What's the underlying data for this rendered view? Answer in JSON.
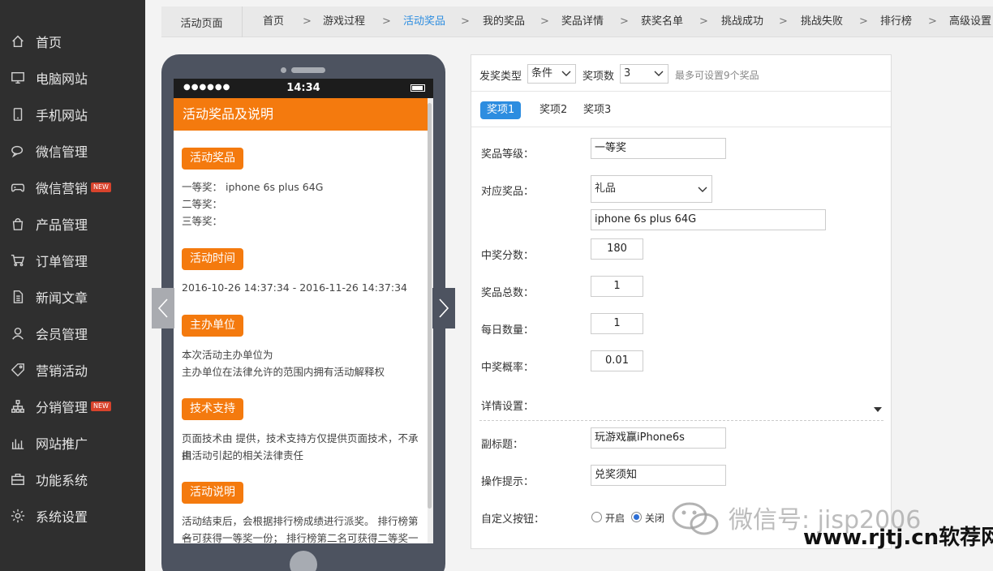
{
  "sidebar": {
    "items": [
      {
        "label": "首页",
        "icon": "home-icon"
      },
      {
        "label": "电脑网站",
        "icon": "monitor-icon"
      },
      {
        "label": "手机网站",
        "icon": "phone-icon"
      },
      {
        "label": "微信管理",
        "icon": "chat-icon"
      },
      {
        "label": "微信营销",
        "icon": "gamepad-icon",
        "badge": "NEW"
      },
      {
        "label": "产品管理",
        "icon": "bag-icon"
      },
      {
        "label": "订单管理",
        "icon": "cart-icon"
      },
      {
        "label": "新闻文章",
        "icon": "document-icon"
      },
      {
        "label": "会员管理",
        "icon": "user-icon"
      },
      {
        "label": "营销活动",
        "icon": "tag-icon"
      },
      {
        "label": "分销管理",
        "icon": "network-icon",
        "badge": "NEW"
      },
      {
        "label": "网站推广",
        "icon": "bar-chart-icon"
      },
      {
        "label": "功能系统",
        "icon": "toolbox-icon"
      },
      {
        "label": "系统设置",
        "icon": "gear-icon"
      }
    ]
  },
  "topnav": {
    "first": "活动页面",
    "items": [
      "首页",
      "游戏过程",
      "活动奖品",
      "我的奖品",
      "奖品详情",
      "获奖名单",
      "挑战成功",
      "挑战失败",
      "排行榜",
      "高级设置"
    ],
    "active_index": 2,
    "separator": ">"
  },
  "phone": {
    "status": {
      "signal": "●●●●●●",
      "time": "14:34"
    },
    "header": "活动奖品及说明",
    "sections": {
      "prize_badge": "活动奖品",
      "prize_lines": [
        "一等奖： iphone 6s plus 64G",
        "二等奖：",
        "三等奖："
      ],
      "time_badge": "活动时间",
      "time_text": "2016-10-26 14:37:34 - 2016-11-26 14:37:34",
      "host_badge": "主办单位",
      "host_lines": [
        "本次活动主办单位为",
        "主办单位在法律允许的范围内拥有活动解释权"
      ],
      "tech_badge": "技术支持",
      "tech_lines": [
        "页面技术由 提供，技术支持方仅提供页面技术，不承担",
        "由活动引起的相关法律责任"
      ],
      "desc_badge": "活动说明",
      "desc_lines": [
        "活动结束后，会根据排行榜成绩进行派奖。 排行榜第一",
        "名可获得一等奖一份； 排行榜第二名可获得二等奖一"
      ]
    }
  },
  "form": {
    "send_type_label": "发奖类型",
    "send_type_value": "条件",
    "prize_count_label": "奖项数",
    "prize_count_value": "3",
    "prize_count_hint": "最多可设置9个奖品",
    "tabs": [
      "奖项1",
      "奖项2",
      "奖项3"
    ],
    "active_tab": 0,
    "level_label": "奖品等级：",
    "level_value": "一等奖",
    "item_label": "对应奖品：",
    "item_select": "礼品",
    "item_name": "iphone 6s plus 64G",
    "score_label": "中奖分数：",
    "score_value": "180",
    "total_label": "奖品总数：",
    "total_value": "1",
    "daily_label": "每日数量：",
    "daily_value": "1",
    "rate_label": "中奖概率：",
    "rate_value": "0.01",
    "detail_label": "详情设置：",
    "subtitle_label": "副标题：",
    "subtitle_value": "玩游戏赢iPhone6s",
    "tip_label": "操作提示：",
    "tip_value": "兑奖须知",
    "custom_btn_label": "自定义按钮：",
    "radio_on": "开启",
    "radio_off": "关闭",
    "radio_selected": "关闭"
  },
  "watermark": {
    "line1": "微信号: jisp2006",
    "line2": "www.rjtj.cn软荐网"
  },
  "colors": {
    "accent": "#f47a0e",
    "active_blue": "#2d8de0",
    "sidebar_bg": "#2f2f2f"
  }
}
